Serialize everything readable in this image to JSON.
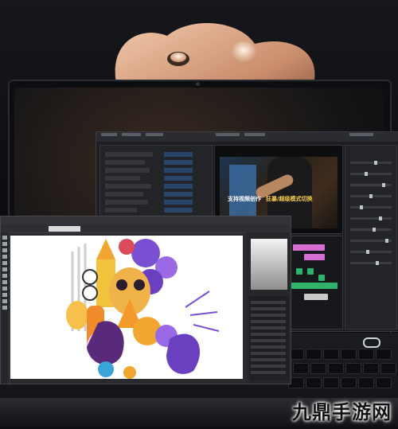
{
  "video_subtitles": {
    "line1": "支持视频创作",
    "line2": "狂暴/超级模式切换"
  },
  "watermark": {
    "text": "九鼎手游网"
  },
  "colors": {
    "sculpture_peach": "#e8b89a",
    "sculpture_shadow": "#7a4a36",
    "premiere_bg": "#1d1e22",
    "timeline_pink": "#d66fd1",
    "timeline_green": "#2fb36a",
    "photoshop_bg": "#2a2b2f",
    "art_purple": "#7b4fd1",
    "art_orange": "#f3a531"
  },
  "icons": [
    "power-button-icon"
  ]
}
